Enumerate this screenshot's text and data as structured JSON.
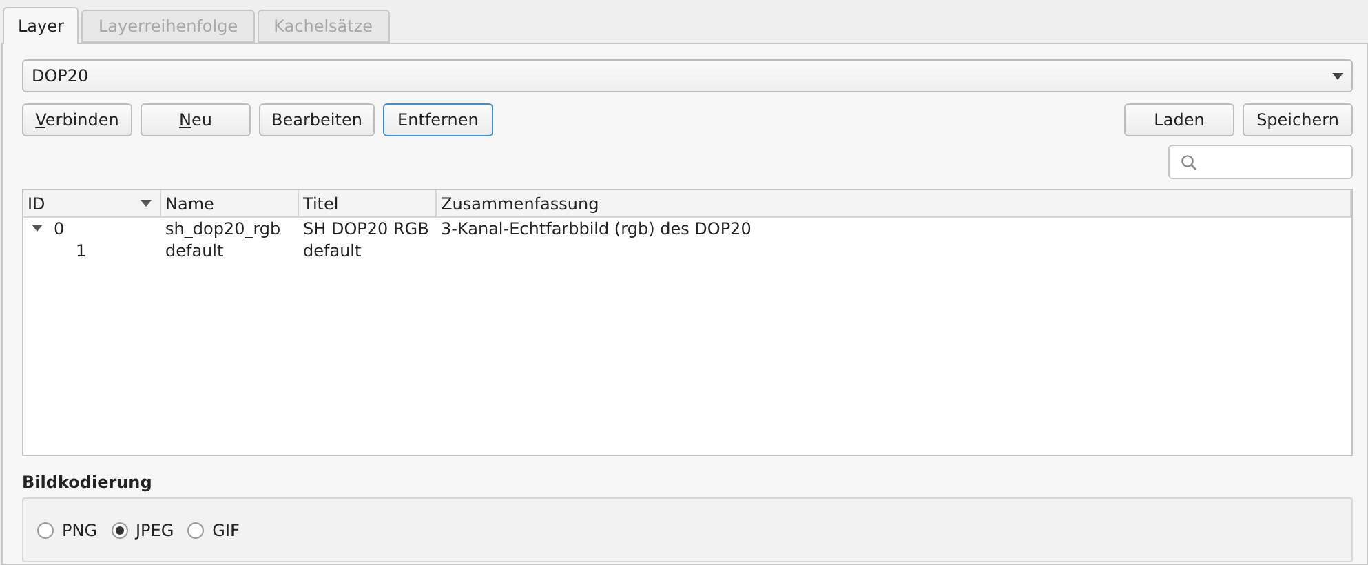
{
  "tabs": [
    {
      "label": "Layer",
      "selected": true,
      "disabled": false
    },
    {
      "label": "Layerreihenfolge",
      "selected": false,
      "disabled": true
    },
    {
      "label": "Kachelsätze",
      "selected": false,
      "disabled": true
    }
  ],
  "layer_select": {
    "value": "DOP20"
  },
  "left_buttons": [
    {
      "label": "Verbinden",
      "mnemonic": true,
      "focused": false
    },
    {
      "label": "Neu",
      "mnemonic": true,
      "focused": false
    },
    {
      "label": "Bearbeiten",
      "mnemonic": false,
      "focused": false
    },
    {
      "label": "Entfernen",
      "mnemonic": false,
      "focused": true
    }
  ],
  "right_buttons": [
    {
      "label": "Laden",
      "mnemonic": false,
      "focused": false
    },
    {
      "label": "Speichern",
      "mnemonic": false,
      "focused": false
    }
  ],
  "table": {
    "columns": [
      {
        "label": "ID",
        "sorted": true
      },
      {
        "label": "Name",
        "sorted": false
      },
      {
        "label": "Titel",
        "sorted": false
      },
      {
        "label": "Zusammenfassung",
        "sorted": false
      }
    ],
    "rows": [
      {
        "id": "0",
        "name": "sh_dop20_rgb",
        "title": "SH DOP20 RGB",
        "summary": "3-Kanal-Echtfarbbild (rgb) des DOP20",
        "expanded": true,
        "children": [
          {
            "id": "1",
            "name": "default",
            "title": "default"
          }
        ]
      }
    ]
  },
  "encoding": {
    "title": "Bildkodierung",
    "options": [
      {
        "label": "PNG",
        "selected": false
      },
      {
        "label": "JPEG",
        "selected": true
      },
      {
        "label": "GIF",
        "selected": false
      }
    ]
  }
}
